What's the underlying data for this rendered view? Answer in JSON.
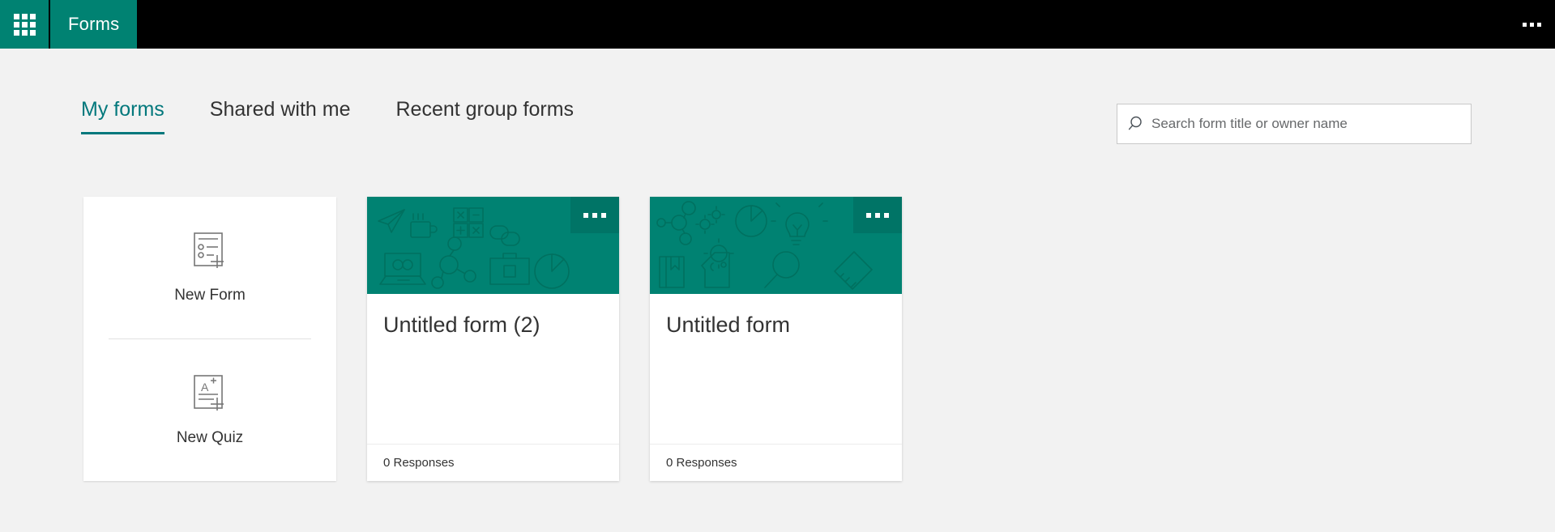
{
  "suite_bar": {
    "waffle_icon": "app-launcher-waffle-icon",
    "app_name": "Forms",
    "overflow_icon": "ellipsis-icon",
    "background": "#000000",
    "accent": "#008272"
  },
  "tabs": [
    {
      "label": "My forms",
      "active": true
    },
    {
      "label": "Shared with me",
      "active": false
    },
    {
      "label": "Recent group forms",
      "active": false
    }
  ],
  "search": {
    "icon": "search-icon",
    "placeholder": "Search form title or owner name",
    "value": ""
  },
  "new_tile": {
    "form": {
      "icon": "new-form-icon",
      "label": "New Form"
    },
    "quiz": {
      "icon": "new-quiz-icon",
      "label": "New Quiz"
    }
  },
  "form_cards": [
    {
      "title": "Untitled form (2)",
      "responses": "0 Responses",
      "more_icon": "ellipsis-icon",
      "hero_color": "#008272",
      "hero_art": [
        "paper-plane-icon",
        "coffee-cup-icon",
        "calculator-icon",
        "chain-link-icon",
        "laptop-infinity-icon",
        "molecule-icon",
        "briefcase-icon",
        "pie-chart-icon"
      ]
    },
    {
      "title": "Untitled form",
      "responses": "0 Responses",
      "more_icon": "ellipsis-icon",
      "hero_color": "#008272",
      "hero_art": [
        "molecule-icon",
        "gears-icon",
        "pie-chart-icon",
        "lightbulb-icon",
        "book-icon",
        "head-gear-icon",
        "magnifier-icon",
        "handshake-icon"
      ]
    }
  ],
  "colors": {
    "page_background": "#f2f2f2",
    "brand_teal": "#008272",
    "tab_active": "#03787c",
    "text": "#333333"
  }
}
